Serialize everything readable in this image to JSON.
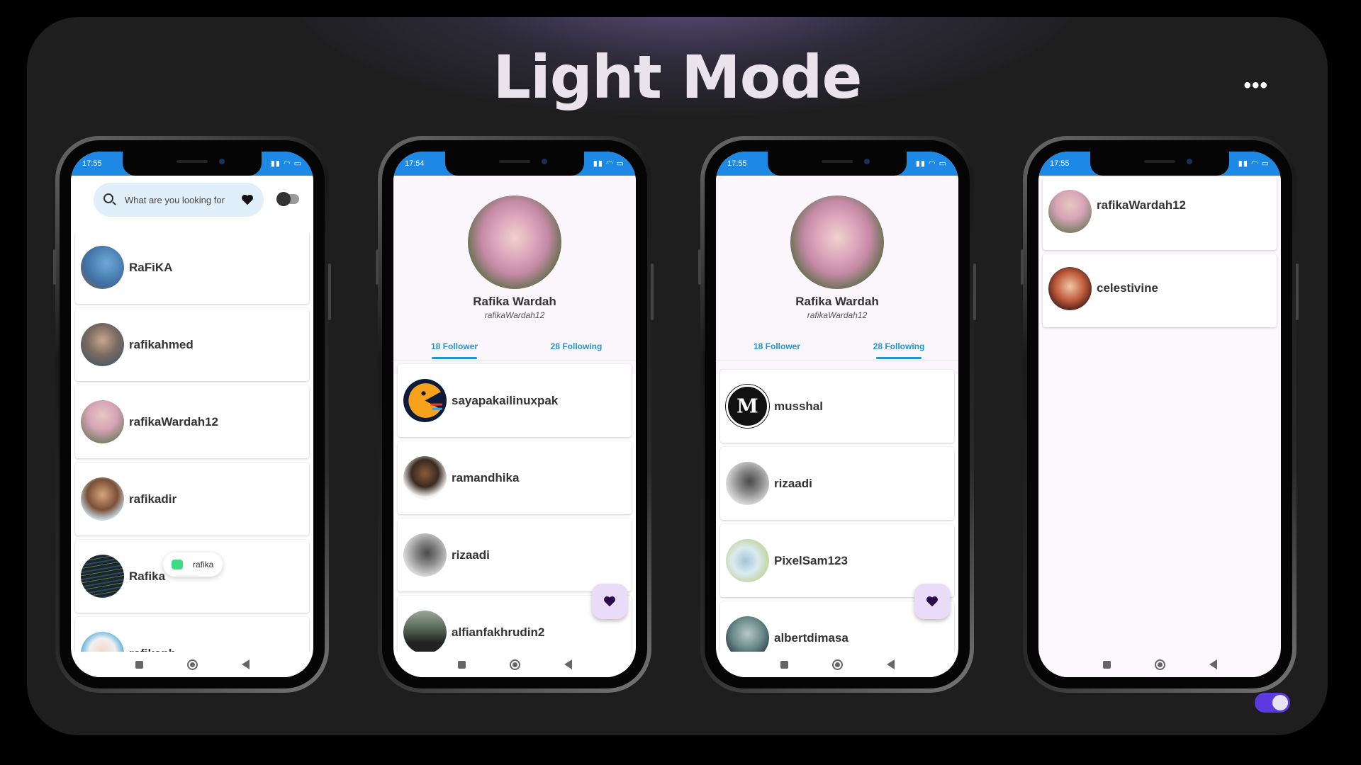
{
  "title": "Light Mode",
  "more_label": "•••",
  "colors": {
    "accent": "#2196c8",
    "statusbar": "#1e88e5",
    "fab": "#eadcf8",
    "toggle": "#5b3be0"
  },
  "phone1": {
    "time": "17:55",
    "search_placeholder": "What are you looking for",
    "users": [
      "RaFiKA",
      "rafikahmed",
      "rafikaWardah12",
      "rafikadir",
      "Rafika",
      "rafikanh"
    ],
    "toast_text": "rafika"
  },
  "phone2": {
    "time": "17:54",
    "name": "Rafika Wardah",
    "handle": "rafikaWardah12",
    "tab_follower": "18 Follower",
    "tab_following": "28 Following",
    "active_tab": "follower",
    "users": [
      "sayapakailinuxpak",
      "ramandhika",
      "rizaadi",
      "alfianfakhrudin2"
    ]
  },
  "phone3": {
    "time": "17:55",
    "name": "Rafika Wardah",
    "handle": "rafikaWardah12",
    "tab_follower": "18 Follower",
    "tab_following": "28 Following",
    "active_tab": "following",
    "users": [
      "musshal",
      "rizaadi",
      "PixelSam123",
      "albertdimasa"
    ]
  },
  "phone4": {
    "time": "17:55",
    "users": [
      "rafikaWardah12",
      "celestivine"
    ]
  }
}
